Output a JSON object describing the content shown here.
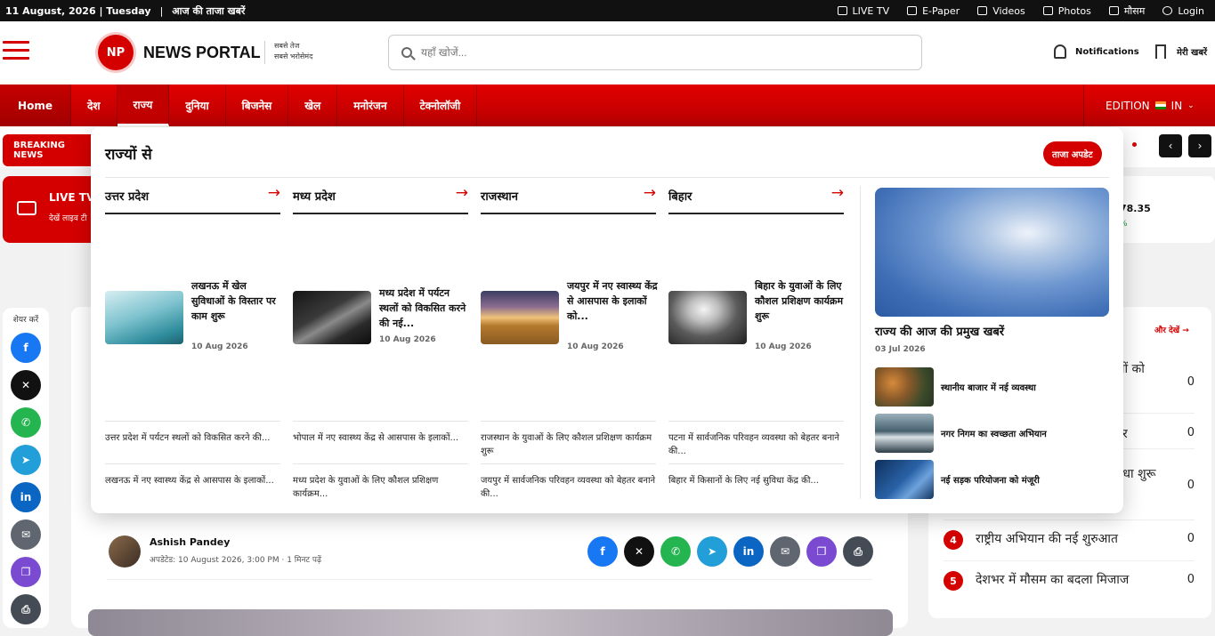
{
  "topbar": {
    "date": "11 August, 2026 | Tuesday",
    "sep": "|",
    "tagline": "आज की ताजा खबरें",
    "links": [
      "LIVE TV",
      "E-Paper",
      "Videos",
      "Photos",
      "मौसम",
      "Login"
    ]
  },
  "header": {
    "logo": "NP",
    "brand": "NEWS PORTAL",
    "tag_line1": "सबसे तेज",
    "tag_line2": "सबसे भरोसेमंद",
    "search_placeholder": "यहाँ खोजें...",
    "notifications": "Notifications",
    "saved": "मेरी खबरें"
  },
  "nav": {
    "items": [
      "Home",
      "देश",
      "राज्य",
      "दुनिया",
      "बिजनेस",
      "खेल",
      "मनोरंजन",
      "टेक्नोलॉजी"
    ],
    "active": "राज्य",
    "edition_label": "EDITION",
    "edition_value": "IN"
  },
  "breaking": {
    "label": "BREAKING NEWS"
  },
  "live_tv": {
    "title": "LIVE TV",
    "subtitle": "देखें लाइव टी"
  },
  "stock": {
    "value": "78.35",
    "change": "%"
  },
  "share_rail": {
    "label": "शेयर करें"
  },
  "colors": {
    "brand_red": "#d40000",
    "facebook": "#1877f2",
    "x": "#111111",
    "whatsapp": "#25b550",
    "telegram": "#229ed9",
    "linkedin": "#0a66c2",
    "email": "#5f6670",
    "copy": "#7a4bd0",
    "print": "#444b55"
  },
  "mega": {
    "heading": "राज्यों से",
    "cta": "ताजा अपडेट",
    "columns": [
      {
        "name": "उत्तर प्रदेश",
        "arrow": "→",
        "card_title": "लखनऊ में खेल सुविधाओं के विस्तार पर काम शुरू",
        "card_date": "10 Aug 2026",
        "links": [
          "उत्तर प्रदेश में पर्यटन स्थलों को विकसित करने की...",
          "लखनऊ में नए स्वास्थ्य केंद्र से आसपास के इलाकों..."
        ]
      },
      {
        "name": "मध्य प्रदेश",
        "arrow": "→",
        "card_title": "मध्य प्रदेश में पर्यटन स्थलों को विकसित करने की नई...",
        "card_date": "10 Aug 2026",
        "links": [
          "भोपाल में नए स्वास्थ्य केंद्र से आसपास के इलाकों...",
          "मध्य प्रदेश के युवाओं के लिए कौशल प्रशिक्षण कार्यक्रम..."
        ]
      },
      {
        "name": "राजस्थान",
        "arrow": "→",
        "card_title": "जयपुर में नए स्वास्थ्य केंद्र से आसपास के इलाकों को...",
        "card_date": "10 Aug 2026",
        "links": [
          "राजस्थान के युवाओं के लिए कौशल प्रशिक्षण कार्यक्रम शुरू",
          "जयपुर में सार्वजनिक परिवहन व्यवस्था को बेहतर बनाने की..."
        ]
      },
      {
        "name": "बिहार",
        "arrow": "→",
        "card_title": "बिहार के युवाओं के लिए कौशल प्रशिक्षण कार्यक्रम शुरू",
        "card_date": "10 Aug 2026",
        "links": [
          "पटना में सार्वजनिक परिवहन व्यवस्था को बेहतर बनाने की...",
          "बिहार में किसानों के लिए नई सुविधा केंद्र की..."
        ]
      }
    ],
    "featured": {
      "title": "राज्य की आज की प्रमुख खबरें",
      "date": "03 Jul 2026",
      "items": [
        "स्थानीय बाजार में नई व्यवस्था",
        "नगर निगम का स्वच्छता अभियान",
        "नई सड़क परियोजना को मंजूरी"
      ]
    }
  },
  "article": {
    "author": "Ashish Pandey",
    "meta": "अपडेटेड: 10 August 2026, 3:00 PM · 1 मिनट पढ़ें"
  },
  "sidebar": {
    "more": "और देखें →",
    "rows": [
      {
        "text": "रियों को",
        "text2": "क",
        "count": "0"
      },
      {
        "text": "र",
        "count": "0"
      },
      {
        "text": "विधा शुरू",
        "count": "0"
      },
      {
        "num": "4",
        "text": "राष्ट्रीय अभियान की नई शुरुआत",
        "count": "0"
      },
      {
        "num": "5",
        "text": "देशभर में मौसम का बदला मिजाज",
        "count": "0"
      }
    ]
  }
}
